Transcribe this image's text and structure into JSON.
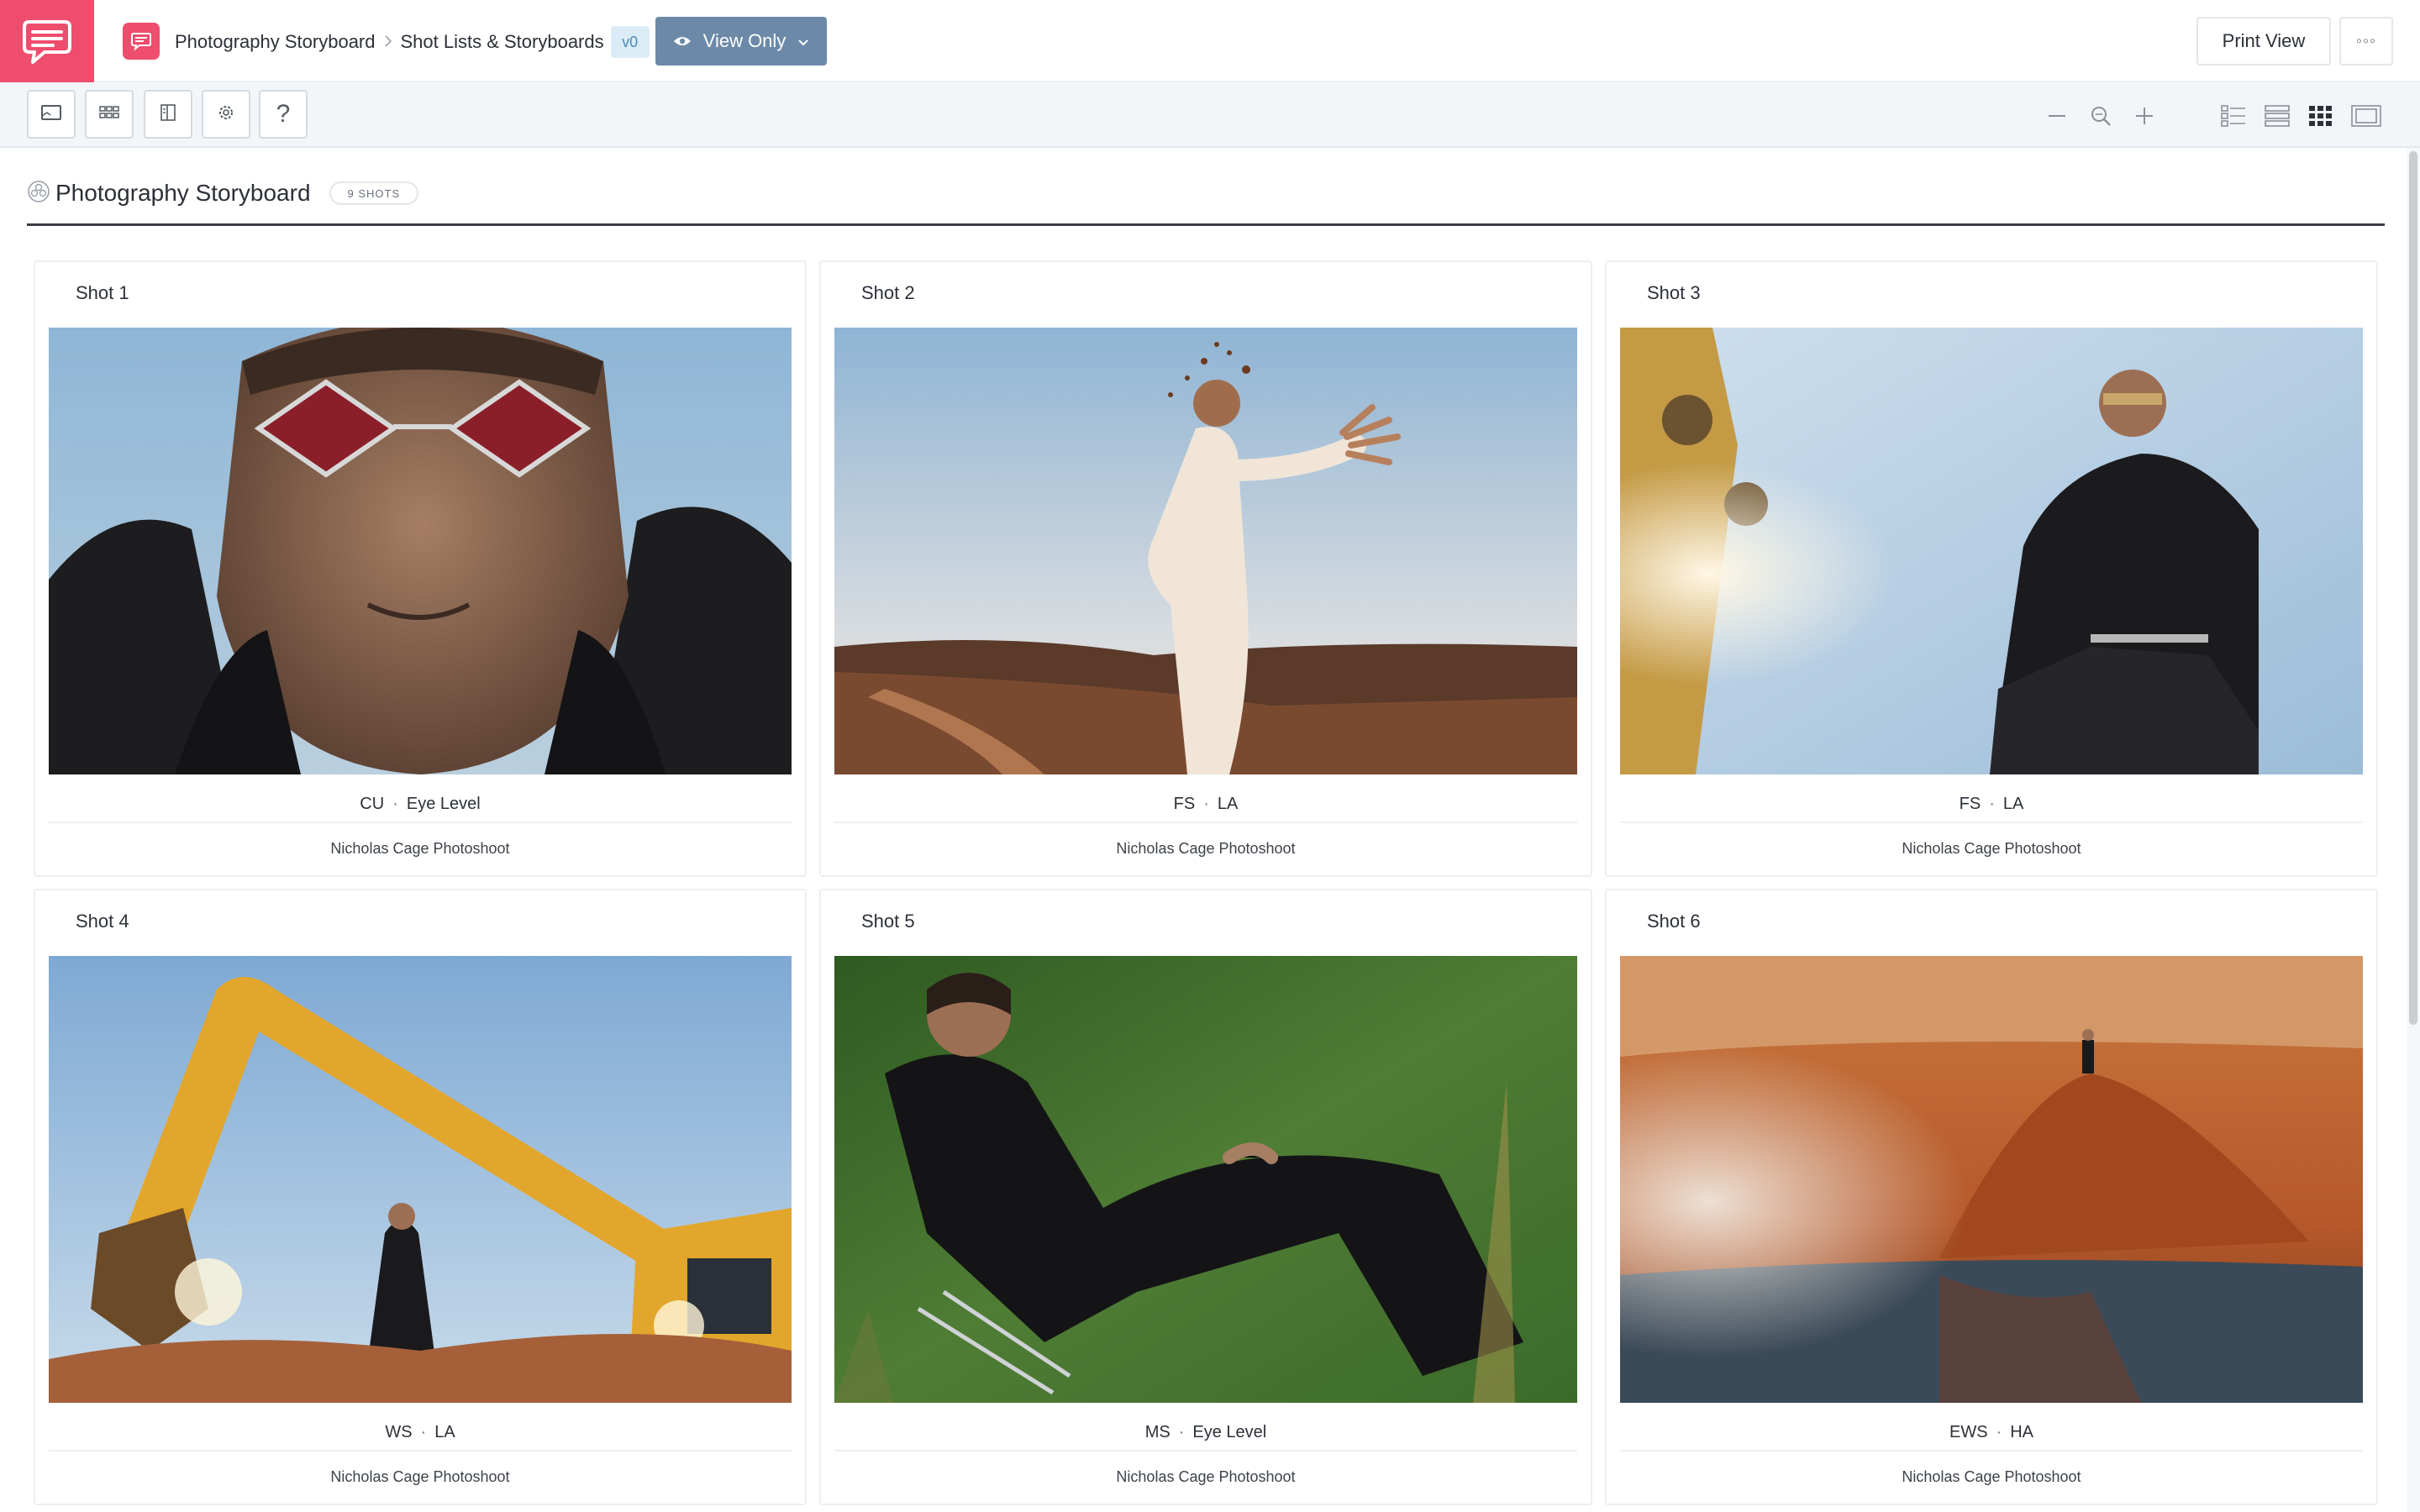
{
  "header": {
    "project_name": "Photography Storyboard",
    "section_name": "Shot Lists & Storyboards",
    "version": "v0",
    "view_mode": "View Only",
    "print_view": "Print View",
    "more": "◦◦◦"
  },
  "toolbar": {
    "icons": [
      "frame-icon",
      "grid-icon",
      "panel-icon",
      "settings-icon",
      "help-icon"
    ],
    "help_glyph": "?",
    "zoom": [
      "zoom-out-icon",
      "zoom-icon",
      "zoom-in-icon"
    ],
    "layouts": [
      "list-view-icon",
      "rows-view-icon",
      "grid-view-icon",
      "film-view-icon"
    ]
  },
  "page": {
    "title": "Photography Storyboard",
    "shot_count": "9 SHOTS"
  },
  "shots": [
    {
      "title": "Shot 1",
      "size": "CU",
      "angle": "Eye Level",
      "description": "Nicholas Cage Photoshoot"
    },
    {
      "title": "Shot 2",
      "size": "FS",
      "angle": "LA",
      "description": "Nicholas Cage Photoshoot"
    },
    {
      "title": "Shot 3",
      "size": "FS",
      "angle": "LA",
      "description": "Nicholas Cage Photoshoot"
    },
    {
      "title": "Shot 4",
      "size": "WS",
      "angle": "LA",
      "description": "Nicholas Cage Photoshoot"
    },
    {
      "title": "Shot 5",
      "size": "MS",
      "angle": "Eye Level",
      "description": "Nicholas Cage Photoshoot"
    },
    {
      "title": "Shot 6",
      "size": "EWS",
      "angle": "HA",
      "description": "Nicholas Cage Photoshoot"
    }
  ],
  "meta_separator": "·",
  "colors": {
    "brand": "#ef4d6d",
    "view_only_button": "#6c8aa8",
    "version_badge_bg": "#dcecf6",
    "toolbar_bg": "#f3f6f9"
  }
}
